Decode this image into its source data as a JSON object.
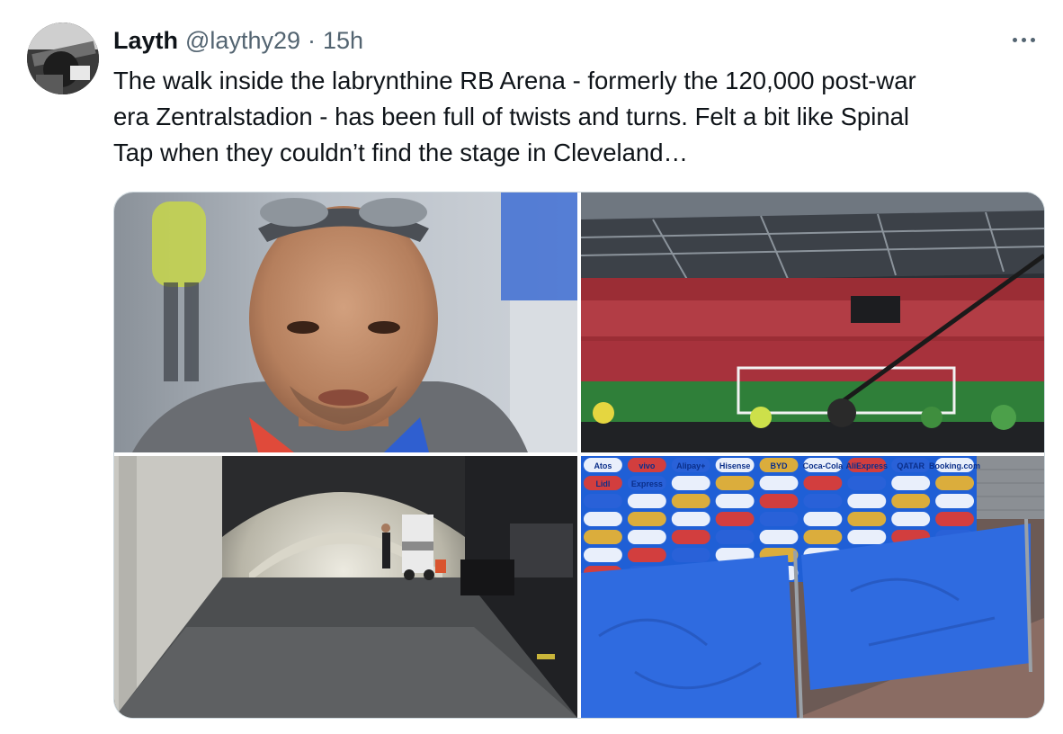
{
  "tweet": {
    "author_name": "Layth",
    "handle": "@laythy29",
    "separator": "·",
    "time": "15h",
    "more_icon": "more-horizontal-icon",
    "text_lines": [
      "The walk inside the labrynthine RB Arena - formerly the 120,000 post-war",
      "era Zentralstadion - has been full of twists and turns. Felt a bit like Spinal",
      "Tap when they couldn’t find the stage in Cleveland…"
    ]
  },
  "media": {
    "photos": [
      {
        "subject": "selfie-photo"
      },
      {
        "subject": "stadium-photo"
      },
      {
        "subject": "tunnel-photo"
      },
      {
        "subject": "sponsor-board-photo"
      }
    ],
    "board_labels": [
      "Atos",
      "vivo",
      "Alipay+",
      "Hisense",
      "BYD",
      "Coca-Cola",
      "AliExpress",
      "QATAR",
      "Booking.com",
      "Lidl",
      "Express"
    ]
  },
  "colors": {
    "text": "#0f1419",
    "secondary": "#536471",
    "border": "#cfd9de",
    "board_blue": "#1f5fd6",
    "fence_blue": "#2f6be0"
  }
}
